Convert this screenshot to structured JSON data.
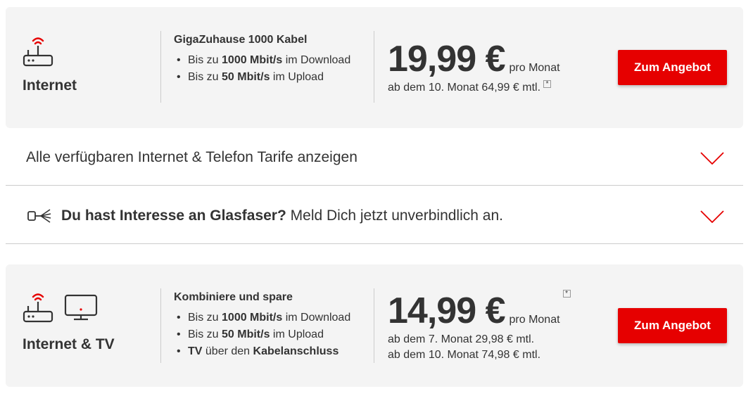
{
  "offers": [
    {
      "category": "Internet",
      "icons": [
        "router-icon"
      ],
      "product_title": "GigaZuhause 1000 Kabel",
      "features": [
        {
          "pre": "Bis zu ",
          "bold": "1000 Mbit/s",
          "post": " im Download"
        },
        {
          "pre": "Bis zu ",
          "bold": "50 Mbit/s",
          "post": " im Upload"
        }
      ],
      "price": "19,99 €",
      "per": "pro Monat",
      "sub_lines": [
        "ab dem 10. Monat 64,99 € mtl."
      ],
      "footnote": "*",
      "button": "Zum Angebot"
    },
    {
      "category": "Internet & TV",
      "icons": [
        "router-icon",
        "tv-icon"
      ],
      "product_title": "Kombiniere und spare",
      "features": [
        {
          "pre": "Bis zu ",
          "bold": "1000 Mbit/s",
          "post": " im Download"
        },
        {
          "pre": "Bis zu ",
          "bold": "50 Mbit/s",
          "post": " im Upload"
        },
        {
          "pre": "",
          "bold": "TV",
          "post": " über den ",
          "bold2": "Kabelanschluss"
        }
      ],
      "price": "14,99 €",
      "per": "pro Monat",
      "sub_lines": [
        "ab dem 7. Monat 29,98 € mtl.",
        "ab dem 10. Monat 74,98 € mtl."
      ],
      "footnote": "*",
      "button": "Zum Angebot"
    }
  ],
  "accordions": [
    {
      "text": "Alle verfügbaren Internet & Telefon Tarife anzeigen",
      "icon": "chevron-down-icon"
    },
    {
      "bold": "Du hast Interesse an Glasfaser?",
      "text": " Meld Dich jetzt unverbindlich an.",
      "icon": "fiber-icon"
    }
  ],
  "colors": {
    "accent": "#e60000",
    "card_bg": "#f4f4f4",
    "text": "#333333",
    "divider": "#cccccc"
  }
}
